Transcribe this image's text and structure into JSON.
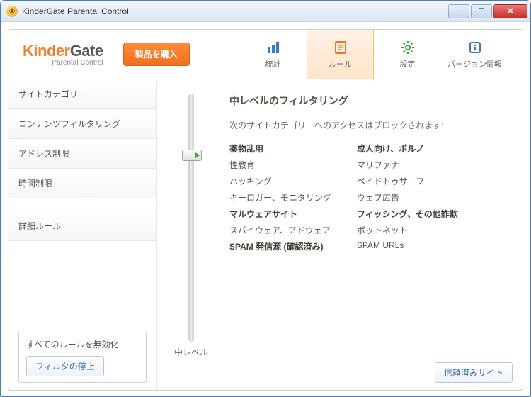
{
  "window": {
    "title": "KinderGate Parental Control"
  },
  "logo": {
    "part1": "Kinder",
    "part2": "Gate",
    "sub": "Parental Control"
  },
  "buy_label": "製品を購入",
  "tabs": {
    "stats": "統計",
    "rules": "ルール",
    "settings": "設定",
    "version": "バージョン情報"
  },
  "sidebar": {
    "items": [
      "サイトカテゴリー",
      "コンテンツフィルタリング",
      "アドレス制限",
      "時間制限"
    ],
    "adv": "詳細ルール",
    "box_title": "すべてのルールを無効化",
    "stop_label": "フィルタの停止"
  },
  "slider": {
    "level_label": "中レベル"
  },
  "content": {
    "heading": "中レベルのフィルタリング",
    "sub": "次のサイトカテゴリーへのアクセスはブロックされます:",
    "col1": [
      {
        "t": "薬物乱用",
        "b": true
      },
      {
        "t": "性教育",
        "b": false
      },
      {
        "t": "ハッキング",
        "b": false
      },
      {
        "t": "キーロガー、モニタリング",
        "b": false
      },
      {
        "t": "マルウェアサイト",
        "b": true
      },
      {
        "t": "スパイウェア、アドウェア",
        "b": false
      },
      {
        "t": "SPAM 発信源 (確認済み)",
        "b": true
      }
    ],
    "col2": [
      {
        "t": "成人向け、ポルノ",
        "b": true
      },
      {
        "t": "マリファナ",
        "b": false
      },
      {
        "t": "ペイドトゥサーフ",
        "b": false
      },
      {
        "t": "ウェブ広告",
        "b": false
      },
      {
        "t": "フィッシング、その他詐欺",
        "b": true
      },
      {
        "t": "ボットネット",
        "b": false
      },
      {
        "t": "SPAM URLs",
        "b": false
      }
    ]
  },
  "trusted_label": "信頼済みサイト"
}
